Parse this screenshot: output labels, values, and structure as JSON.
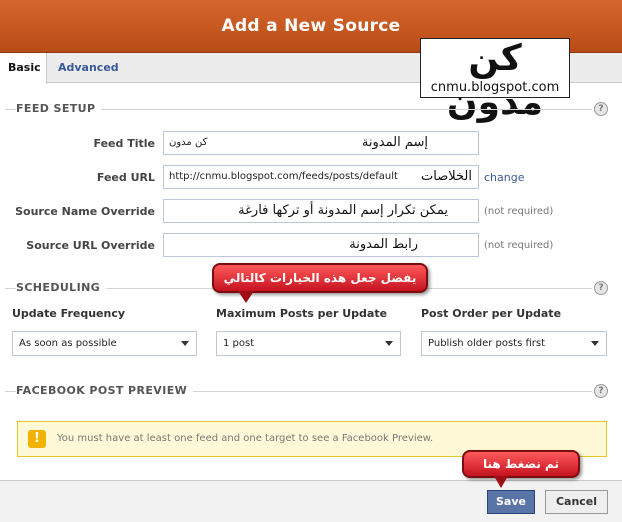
{
  "dialog": {
    "title": "Add a New Source"
  },
  "tabs": [
    {
      "label": "Basic"
    },
    {
      "label": "Advanced"
    }
  ],
  "logo": {
    "text": "كن مدون",
    "url_text": "cnmu.blogspot.com"
  },
  "feed_setup": {
    "heading": "FEED SETUP",
    "help": "?",
    "feed_title": {
      "label": "Feed Title",
      "value": "كن مدون",
      "annotation": "إسم المدونة"
    },
    "feed_url": {
      "label": "Feed URL",
      "value": "http://cnmu.blogspot.com/feeds/posts/default",
      "annotation": "الخلاصات",
      "change_link": "change"
    },
    "source_name": {
      "label": "Source Name Override",
      "annotation": "يمكن تكرار إسم المدونة أو تركها فارغة",
      "note": "(not required)"
    },
    "source_url": {
      "label": "Source URL Override",
      "annotation": "رابط المدونة",
      "note": "(not required)"
    }
  },
  "scheduling": {
    "heading": "SCHEDULING",
    "help": "?",
    "callout": "يفضل جعل هذه الخيارات كالتالي",
    "update_frequency": {
      "label": "Update Frequency",
      "value": "As soon as possible"
    },
    "max_posts": {
      "label": "Maximum Posts per Update",
      "value": "1 post"
    },
    "post_order": {
      "label": "Post Order per Update",
      "value": "Publish older posts first"
    }
  },
  "preview": {
    "heading": "FACEBOOK POST PREVIEW",
    "help": "?",
    "warning_icon": "!",
    "warning_text": "You must have at least one feed and one target to see a Facebook Preview."
  },
  "footer": {
    "callout": "ثم نضغط هنا",
    "save_label": "Save",
    "cancel_label": "Cancel"
  },
  "colors": {
    "title_bar": "#c65620",
    "accent_blue": "#3b5998",
    "callout_red": "#d7141f",
    "warning_bg": "#fff9d7"
  }
}
